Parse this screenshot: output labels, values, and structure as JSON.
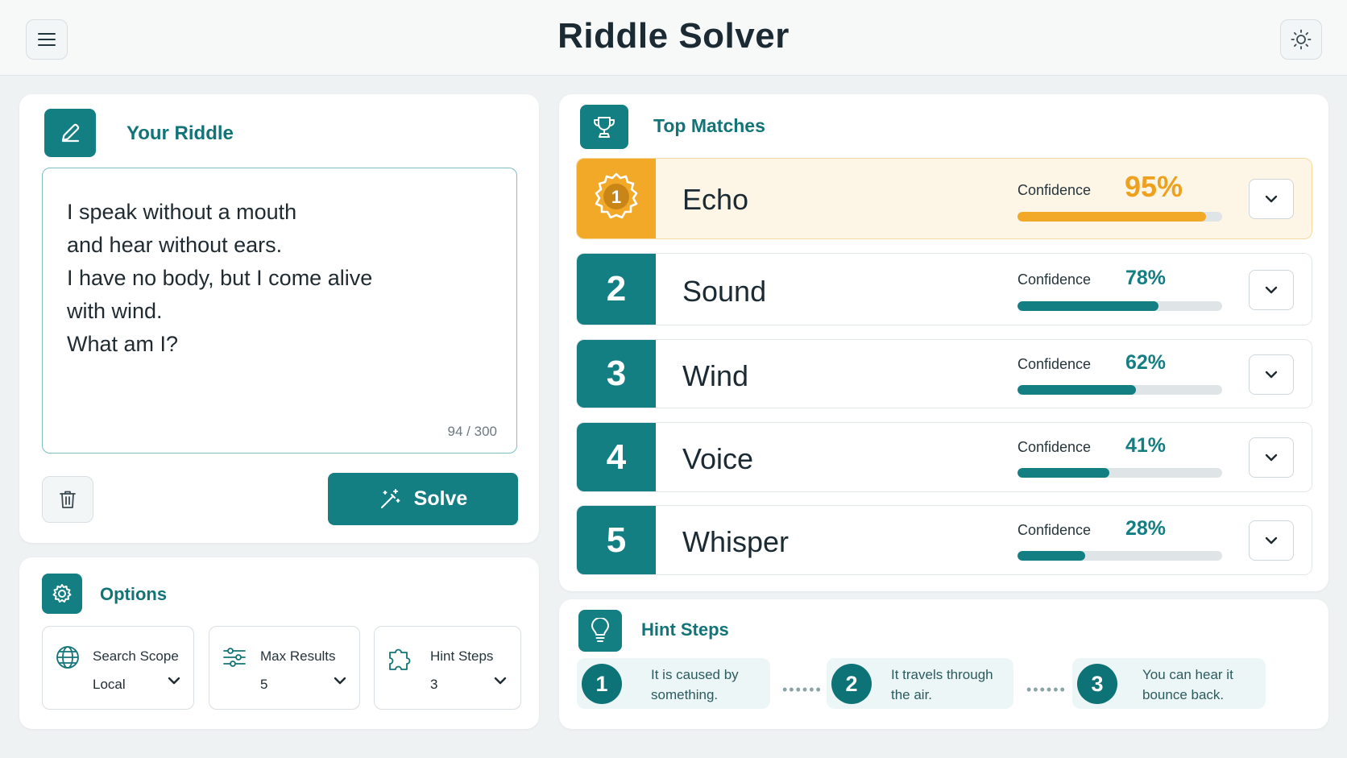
{
  "header": {
    "title": "Riddle Solver",
    "menu_icon": "hamburger-menu-icon",
    "theme_icon": "sun-icon"
  },
  "riddle": {
    "title": "Your Riddle",
    "lines": [
      "I speak without a mouth",
      "and hear without ears.",
      "I have no body, but I come alive",
      "with wind.",
      "What am I?"
    ],
    "char_count": "94 / 300",
    "solve_label": "Solve"
  },
  "options": {
    "title": "Options",
    "items": [
      {
        "label": "Search Scope",
        "value": "Local",
        "icon": "globe-icon"
      },
      {
        "label": "Max Results",
        "value": "5",
        "icon": "sliders-icon"
      },
      {
        "label": "Hint Steps",
        "value": "3",
        "icon": "puzzle-icon"
      }
    ]
  },
  "matches": {
    "title": "Top Matches",
    "confidence_label": "Confidence",
    "items": [
      {
        "rank": "1",
        "name": "Echo",
        "confidence": "95%",
        "fraction": 0.92
      },
      {
        "rank": "2",
        "name": "Sound",
        "confidence": "78%",
        "fraction": 0.69
      },
      {
        "rank": "3",
        "name": "Wind",
        "confidence": "62%",
        "fraction": 0.58
      },
      {
        "rank": "4",
        "name": "Voice",
        "confidence": "41%",
        "fraction": 0.45
      },
      {
        "rank": "5",
        "name": "Whisper",
        "confidence": "28%",
        "fraction": 0.33
      }
    ]
  },
  "hints": {
    "title": "Hint Steps",
    "items": [
      {
        "num": "1",
        "lines": [
          "It is caused by",
          "something."
        ]
      },
      {
        "num": "2",
        "lines": [
          "It travels through",
          "the air."
        ]
      },
      {
        "num": "3",
        "lines": [
          "You can hear it",
          "bounce back."
        ]
      }
    ]
  },
  "colors": {
    "accent": "#137f83",
    "gold": "#f2a928",
    "background": "#eef2f3"
  }
}
